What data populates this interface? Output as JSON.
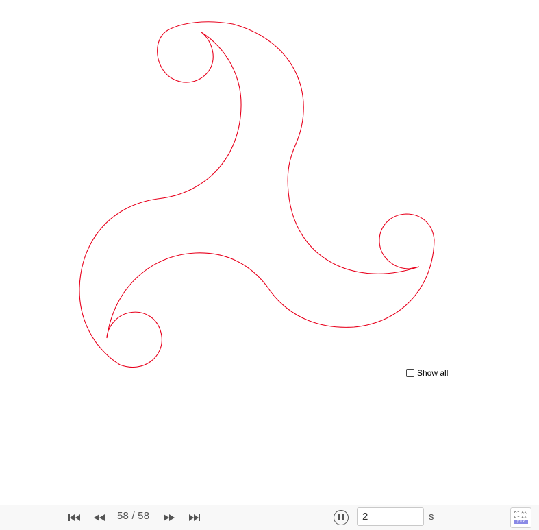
{
  "canvas": {
    "curve_color": "#e8001c",
    "checkbox": {
      "label": "Show all",
      "checked": false
    }
  },
  "toolbar": {
    "nav_buttons": [
      "first-step-icon",
      "previous-step-icon",
      "next-step-icon",
      "last-step-icon"
    ],
    "step_current": "58",
    "step_separator": "/",
    "step_total": "58",
    "step_text": "58 / 58",
    "playback_icon": "pause-icon",
    "speed_value": "2",
    "speed_unit": "s",
    "algebra_icon": {
      "name": "algebra-view-icon",
      "lines": [
        "A = (1,1)",
        "B = (2,2)",
        "y = x"
      ]
    },
    "icon_color": "#555555"
  }
}
